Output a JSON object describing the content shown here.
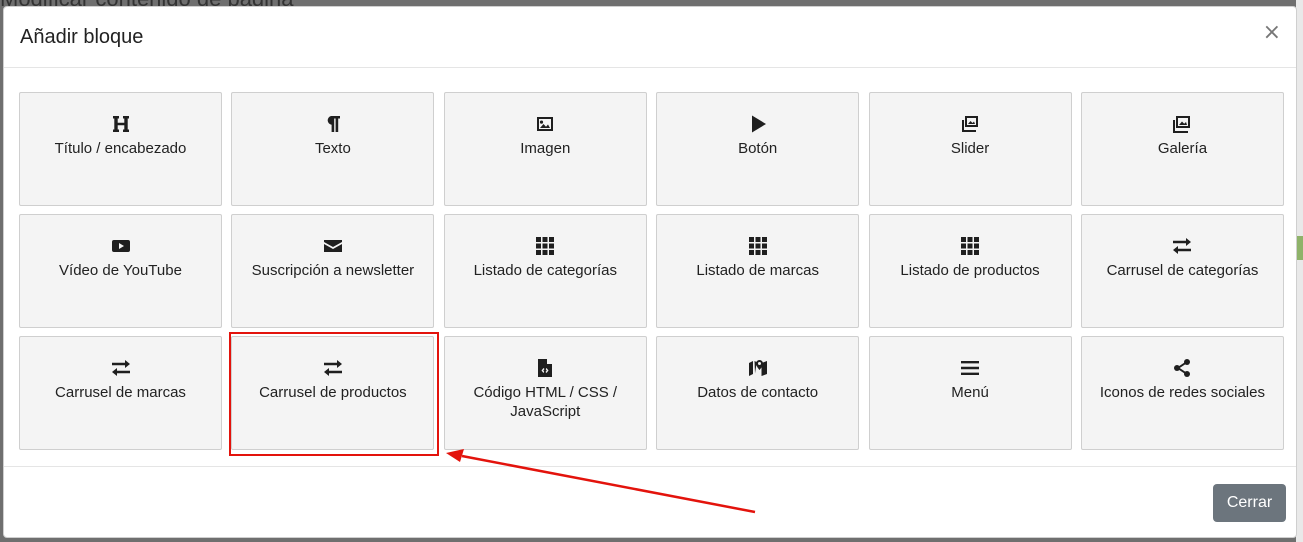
{
  "background": {
    "page_heading": "Modificar contenido de página"
  },
  "modal": {
    "title": "Añadir bloque",
    "close_symbol": "×",
    "close_button_label": "Cerrar"
  },
  "blocks": [
    {
      "label": "Título / encabezado",
      "icon": "heading-icon"
    },
    {
      "label": "Texto",
      "icon": "paragraph-icon"
    },
    {
      "label": "Imagen",
      "icon": "image-icon"
    },
    {
      "label": "Botón",
      "icon": "play-icon"
    },
    {
      "label": "Slider",
      "icon": "images-icon"
    },
    {
      "label": "Galería",
      "icon": "gallery-icon"
    },
    {
      "label": "Vídeo de YouTube",
      "icon": "youtube-icon"
    },
    {
      "label": "Suscripción a newsletter",
      "icon": "envelope-icon"
    },
    {
      "label": "Listado de categorías",
      "icon": "grid-icon"
    },
    {
      "label": "Listado de marcas",
      "icon": "grid-icon"
    },
    {
      "label": "Listado de productos",
      "icon": "grid-icon"
    },
    {
      "label": "Carrusel de categorías",
      "icon": "exchange-icon"
    },
    {
      "label": "Carrusel de marcas",
      "icon": "exchange-icon"
    },
    {
      "label": "Carrusel de productos",
      "icon": "exchange-icon"
    },
    {
      "label": "Código HTML / CSS / JavaScript",
      "icon": "file-code-icon"
    },
    {
      "label": "Datos de contacto",
      "icon": "map-marker-icon"
    },
    {
      "label": "Menú",
      "icon": "bars-icon"
    },
    {
      "label": "Iconos de redes sociales",
      "icon": "share-icon"
    }
  ],
  "annotation": {
    "highlighted_block": "Carrusel de productos",
    "highlight_color": "#e3130c"
  },
  "colors": {
    "tile_background": "#f4f4f4",
    "button_background": "#6c757d"
  }
}
